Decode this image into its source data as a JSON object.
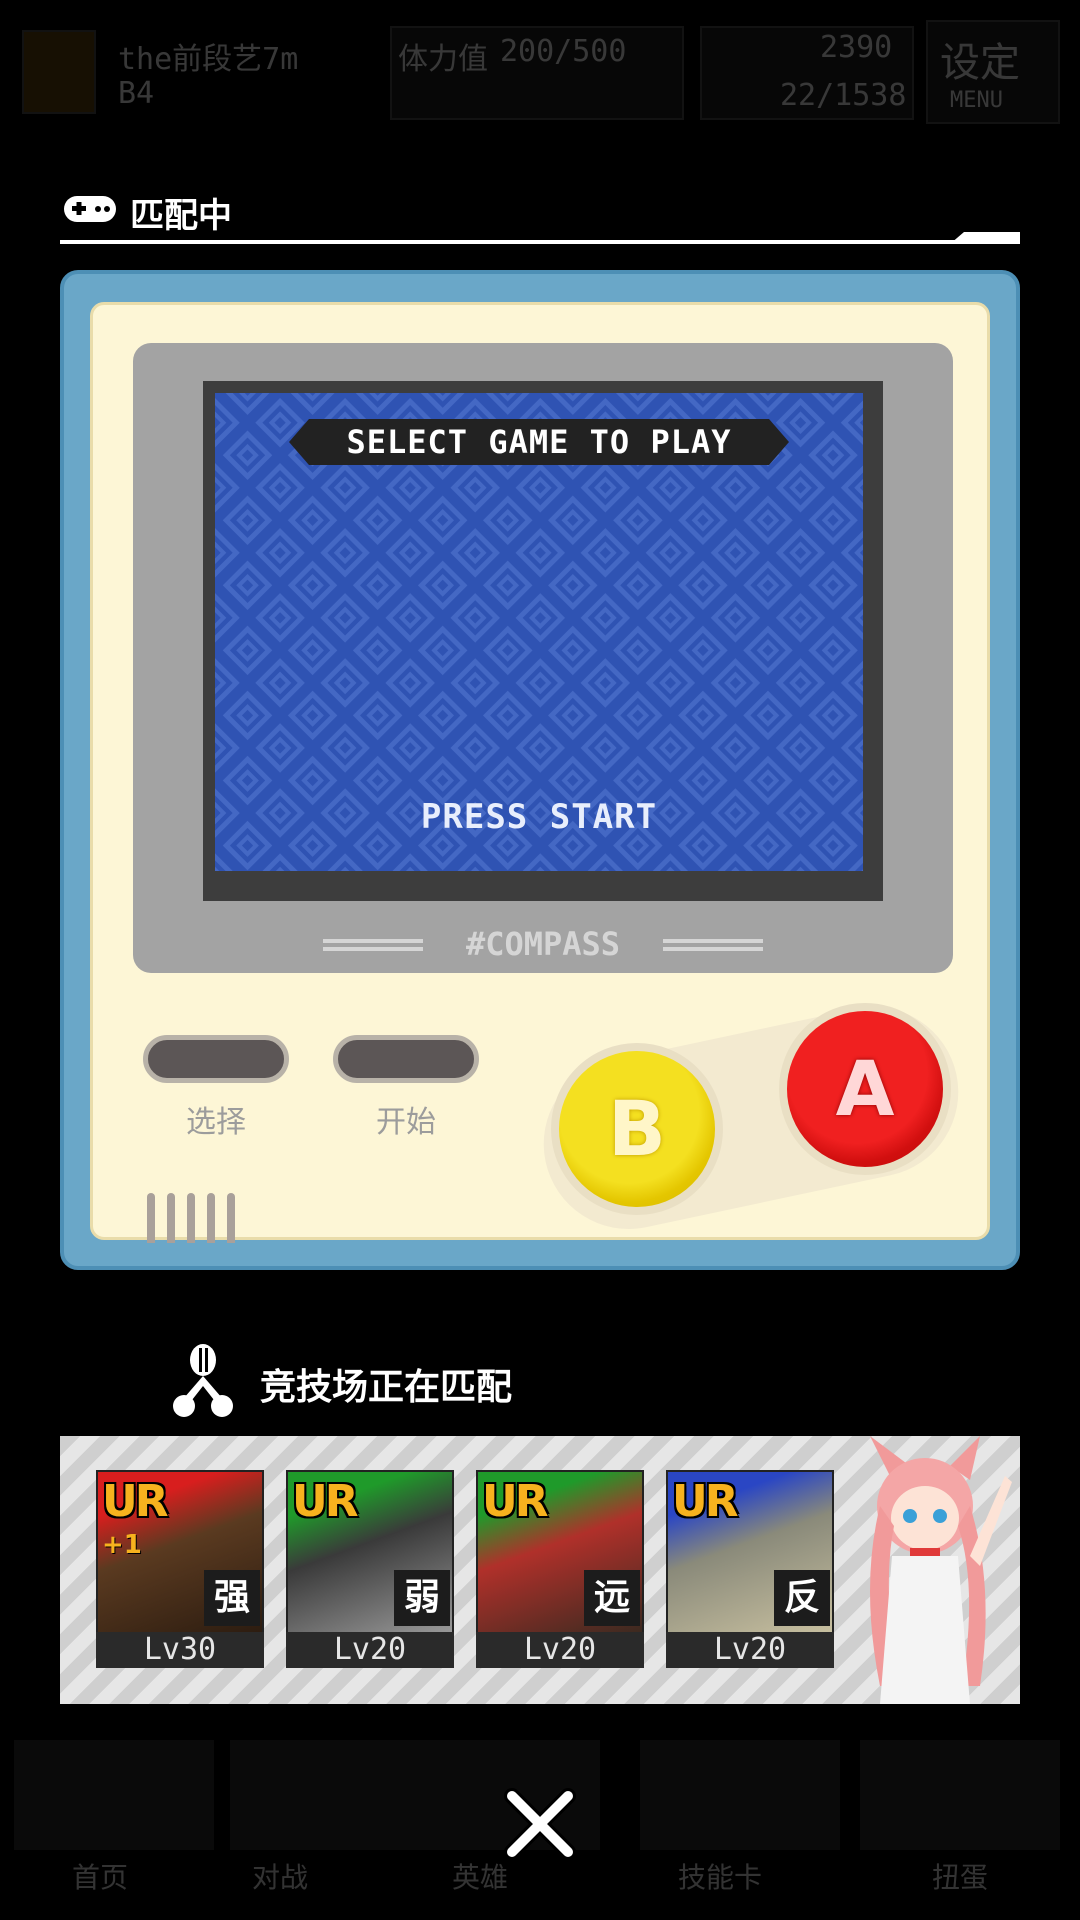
{
  "hud": {
    "player_name": "the前段艺7m",
    "rank_label": "B4",
    "stamina_label": "体力值",
    "stamina_value": "200/500",
    "coins": "2390",
    "gems": "22/1538",
    "settings_label": "设定",
    "menu_label": "MENU"
  },
  "header": {
    "title": "匹配中",
    "icon": "gamepad-icon"
  },
  "console": {
    "screen_banner": "SELECT GAME TO PLAY",
    "screen_prompt": "PRESS START",
    "brand": "#COMPASS",
    "select_label": "选择",
    "start_label": "开始",
    "b_label": "B",
    "a_label": "A",
    "colors": {
      "shell": "#6aa7c8",
      "body": "#fdf6d6",
      "screen": "#2f53b3",
      "button_b": "#f4e020",
      "button_a": "#f02020"
    }
  },
  "status": {
    "icon": "hero-silhouette-icon",
    "text": "竞技场正在匹配"
  },
  "deck": {
    "cards": [
      {
        "rarity": "UR",
        "plus": "+1",
        "trait": "强",
        "level": "Lv30",
        "color": "#d81e1e"
      },
      {
        "rarity": "UR",
        "plus": "",
        "trait": "弱",
        "level": "Lv20",
        "color": "#1f9a2a"
      },
      {
        "rarity": "UR",
        "plus": "",
        "trait": "远",
        "level": "Lv20",
        "color": "#1f9a2a"
      },
      {
        "rarity": "UR",
        "plus": "",
        "trait": "反",
        "level": "Lv20",
        "color": "#2a46c4"
      }
    ]
  },
  "bottom_nav": {
    "items": [
      "首页",
      "对战",
      "英雄",
      "技能卡",
      "扭蛋"
    ]
  },
  "close_icon": "close-icon"
}
